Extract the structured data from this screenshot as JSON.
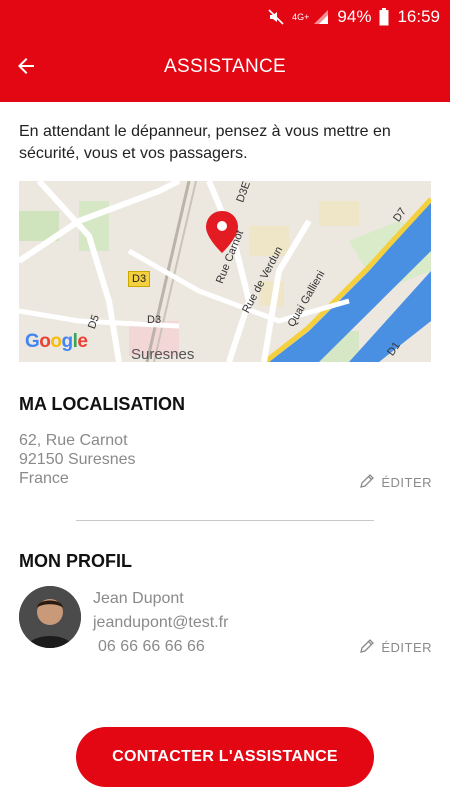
{
  "status_bar": {
    "network": "4G+",
    "battery": "94%",
    "time": "16:59"
  },
  "app_bar": {
    "title": "ASSISTANCE",
    "back_icon": "arrow-left-icon"
  },
  "intro_text": "En attendant le dépanneur, pensez à vous mettre en sécurité, vous et vos passagers.",
  "map": {
    "labels": {
      "d3e": "D3E",
      "rue_carnot": "Rue Carnot",
      "rue_de_verdun": "Rue de Verdun",
      "quai_gallieni": "Quai Gallieni",
      "d3": "D3",
      "d3_badge": "D3",
      "d5": "D5",
      "d7": "D7",
      "d1": "D1",
      "city": "Suresnes"
    },
    "logo": "Google"
  },
  "location": {
    "title": "MA LOCALISATION",
    "address_line1": "62, Rue Carnot",
    "address_line2": "92150 Suresnes",
    "address_line3": "France",
    "edit_label": "ÉDITER"
  },
  "profile": {
    "title": "MON PROFIL",
    "name": "Jean Dupont",
    "email": "jeandupont@test.fr",
    "phone": "06 66 66 66 66",
    "edit_label": "ÉDITER"
  },
  "cta_label": "CONTACTER L'ASSISTANCE",
  "colors": {
    "brand_red": "#e30613",
    "text_grey": "#8a8a8a",
    "map_river": "#4a90e2",
    "map_road_yellow": "#f4d03f"
  }
}
